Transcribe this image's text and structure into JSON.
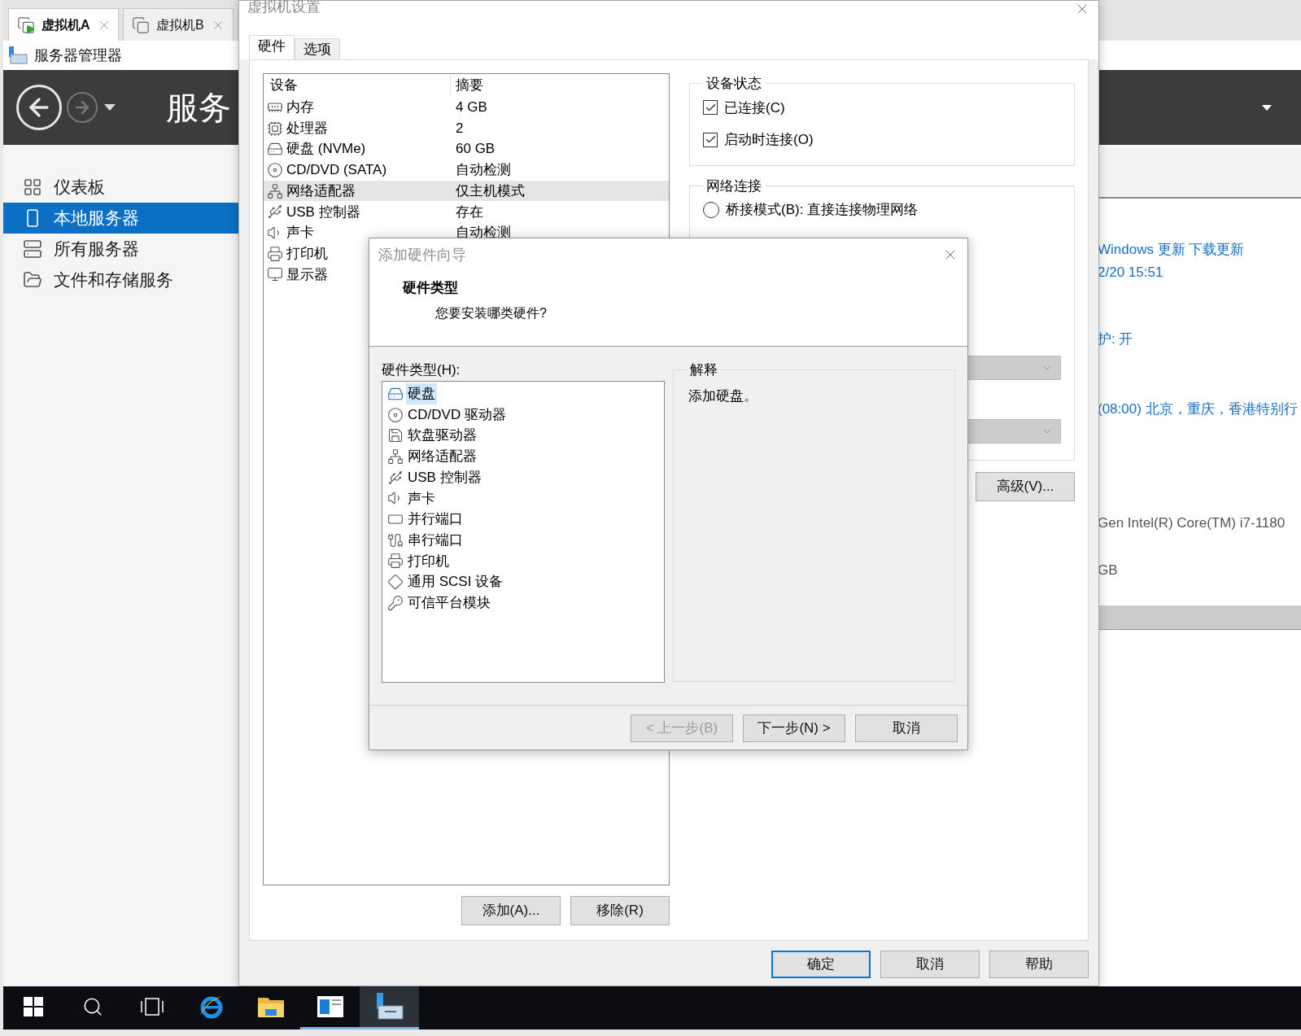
{
  "server_manager": {
    "tabs": [
      {
        "label": "虚拟机A",
        "selected": true,
        "kind": "running"
      },
      {
        "label": "虚拟机B",
        "selected": false,
        "kind": "stopped"
      }
    ],
    "title": "服务器管理器",
    "header_title": "服务",
    "sidebar": [
      {
        "label": "仪表板",
        "kind": "dashboard",
        "selected": false
      },
      {
        "label": "本地服务器",
        "kind": "local",
        "selected": true
      },
      {
        "label": "所有服务器",
        "kind": "all",
        "selected": false
      },
      {
        "label": "文件和存储服务",
        "kind": "files",
        "selected": false
      }
    ],
    "details": [
      {
        "text": "Windows 更新 下载更新",
        "kind": "link"
      },
      {
        "text": "2/20 15:51",
        "kind": "link"
      },
      {
        "text": "护: 开",
        "kind": "link"
      },
      {
        "text": "(08:00) 北京，重庆，香港特别行",
        "kind": "link"
      },
      {
        "text": "Gen Intel(R) Core(TM) i7-1180",
        "kind": "plain"
      },
      {
        "text": "GB",
        "kind": "plain"
      }
    ]
  },
  "settings": {
    "title": "虚拟机设置",
    "tabs": [
      {
        "label": "硬件",
        "selected": true
      },
      {
        "label": "选项",
        "selected": false
      }
    ],
    "device_columns": [
      "设备",
      "摘要"
    ],
    "devices": [
      {
        "name": "内存",
        "summary": "4 GB",
        "kind": "memory",
        "selected": false
      },
      {
        "name": "处理器",
        "summary": "2",
        "kind": "cpu",
        "selected": false
      },
      {
        "name": "硬盘 (NVMe)",
        "summary": "60 GB",
        "kind": "disk",
        "selected": false
      },
      {
        "name": "CD/DVD (SATA)",
        "summary": "自动检测",
        "kind": "cd",
        "selected": false
      },
      {
        "name": "网络适配器",
        "summary": "仅主机模式",
        "kind": "network",
        "selected": true
      },
      {
        "name": "USB 控制器",
        "summary": "存在",
        "kind": "usb",
        "selected": false
      },
      {
        "name": "声卡",
        "summary": "自动检测",
        "kind": "sound",
        "selected": false
      },
      {
        "name": "打印机",
        "kind": "printer",
        "selected": false
      },
      {
        "name": "显示器",
        "kind": "display",
        "selected": false
      }
    ],
    "device_buttons": [
      "添加(A)...",
      "移除(R)"
    ],
    "device_status": {
      "title": "设备状态",
      "options": [
        {
          "label": "已连接(C)",
          "checked": true
        },
        {
          "label": "启动时连接(O)",
          "checked": true
        }
      ]
    },
    "network": {
      "title": "网络连接",
      "bridge": {
        "label": "桥接模式(B): 直接连接物理网络",
        "selected": false
      }
    },
    "advanced_button": "高级(V)...",
    "buttons": [
      {
        "label": "确定",
        "default": true
      },
      {
        "label": "取消",
        "default": false
      },
      {
        "label": "帮助",
        "default": false
      }
    ]
  },
  "wizard": {
    "title": "添加硬件向导",
    "heading": "硬件类型",
    "subheading": "您要安装哪类硬件?",
    "list_label": "硬件类型(H):",
    "types": [
      {
        "label": "硬盘",
        "kind": "disk",
        "selected": true
      },
      {
        "label": "CD/DVD 驱动器",
        "kind": "cd",
        "selected": false
      },
      {
        "label": "软盘驱动器",
        "kind": "floppy",
        "selected": false
      },
      {
        "label": "网络适配器",
        "kind": "network",
        "selected": false
      },
      {
        "label": "USB 控制器",
        "kind": "usb",
        "selected": false
      },
      {
        "label": "声卡",
        "kind": "sound",
        "selected": false
      },
      {
        "label": "并行端口",
        "kind": "parallel",
        "selected": false
      },
      {
        "label": "串行端口",
        "kind": "serial",
        "selected": false
      },
      {
        "label": "打印机",
        "kind": "printer",
        "selected": false
      },
      {
        "label": "通用 SCSI 设备",
        "kind": "scsi",
        "selected": false
      },
      {
        "label": "可信平台模块",
        "kind": "tpm",
        "selected": false
      }
    ],
    "explanation_title": "解释",
    "explanation": "添加硬盘。",
    "buttons": [
      {
        "label": "< 上一步(B)",
        "disabled": true
      },
      {
        "label": "下一步(N) >",
        "disabled": false
      },
      {
        "label": "取消",
        "disabled": false
      }
    ]
  },
  "taskbar": [
    {
      "kind": "start",
      "running": false,
      "selected": false
    },
    {
      "kind": "search",
      "running": false,
      "selected": false
    },
    {
      "kind": "taskview",
      "running": false,
      "selected": false
    },
    {
      "kind": "ie",
      "running": false,
      "selected": false
    },
    {
      "kind": "explorer",
      "running": false,
      "selected": false
    },
    {
      "kind": "app",
      "running": true,
      "selected": false
    },
    {
      "kind": "server",
      "running": true,
      "selected": true
    }
  ]
}
